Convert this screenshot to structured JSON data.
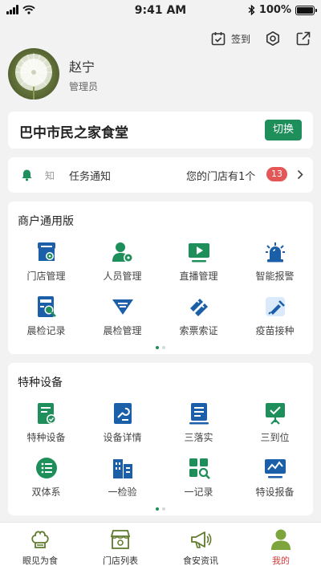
{
  "status_bar": {
    "time": "9:41 AM",
    "battery": "100%",
    "battery_level": 1.0
  },
  "actions": {
    "checkin_label": "签到"
  },
  "profile": {
    "name": "赵宁",
    "role": "管理员"
  },
  "store": {
    "name": "巴中市民之家食堂",
    "switch_label": "切换"
  },
  "notice": {
    "label": "知",
    "title": "任务通知",
    "message": "您的门店有1个",
    "count": "13"
  },
  "merchant_section": {
    "title": "商户通用版",
    "items": [
      {
        "label": "门店管理",
        "icon": "store-settings-icon"
      },
      {
        "label": "人员管理",
        "icon": "user-settings-icon"
      },
      {
        "label": "直播管理",
        "icon": "live-play-icon"
      },
      {
        "label": "智能报警",
        "icon": "alarm-light-icon"
      },
      {
        "label": "晨检记录",
        "icon": "morning-check-record-icon"
      },
      {
        "label": "晨检管理",
        "icon": "morning-check-manage-icon"
      },
      {
        "label": "索票索证",
        "icon": "ticket-icon"
      },
      {
        "label": "疫苗接种",
        "icon": "vaccine-icon"
      }
    ],
    "pages": 2,
    "active_page": 1
  },
  "special_section": {
    "title": "特种设备",
    "items": [
      {
        "label": "特种设备",
        "icon": "special-equipment-icon"
      },
      {
        "label": "设备详情",
        "icon": "equipment-detail-icon"
      },
      {
        "label": "三落实",
        "icon": "document-list-icon"
      },
      {
        "label": "三到位",
        "icon": "board-icon"
      },
      {
        "label": "双体系",
        "icon": "list-circle-icon"
      },
      {
        "label": "一检验",
        "icon": "building-icon"
      },
      {
        "label": "一记录",
        "icon": "grid-search-icon"
      },
      {
        "label": "特设报备",
        "icon": "monitor-chart-icon"
      }
    ],
    "pages": 2,
    "active_page": 1
  },
  "tabbar": {
    "tabs": [
      {
        "label": "眼见为食",
        "icon": "chef-hat-icon"
      },
      {
        "label": "门店列表",
        "icon": "shop-icon"
      },
      {
        "label": "食安资讯",
        "icon": "megaphone-icon"
      },
      {
        "label": "我的",
        "icon": "user-icon"
      }
    ],
    "active": 3
  },
  "colors": {
    "brand_green": "#1e8e5a",
    "icon_blue": "#1a5fa8",
    "badge_red": "#e35757",
    "active_tab": "#d53a3a"
  }
}
